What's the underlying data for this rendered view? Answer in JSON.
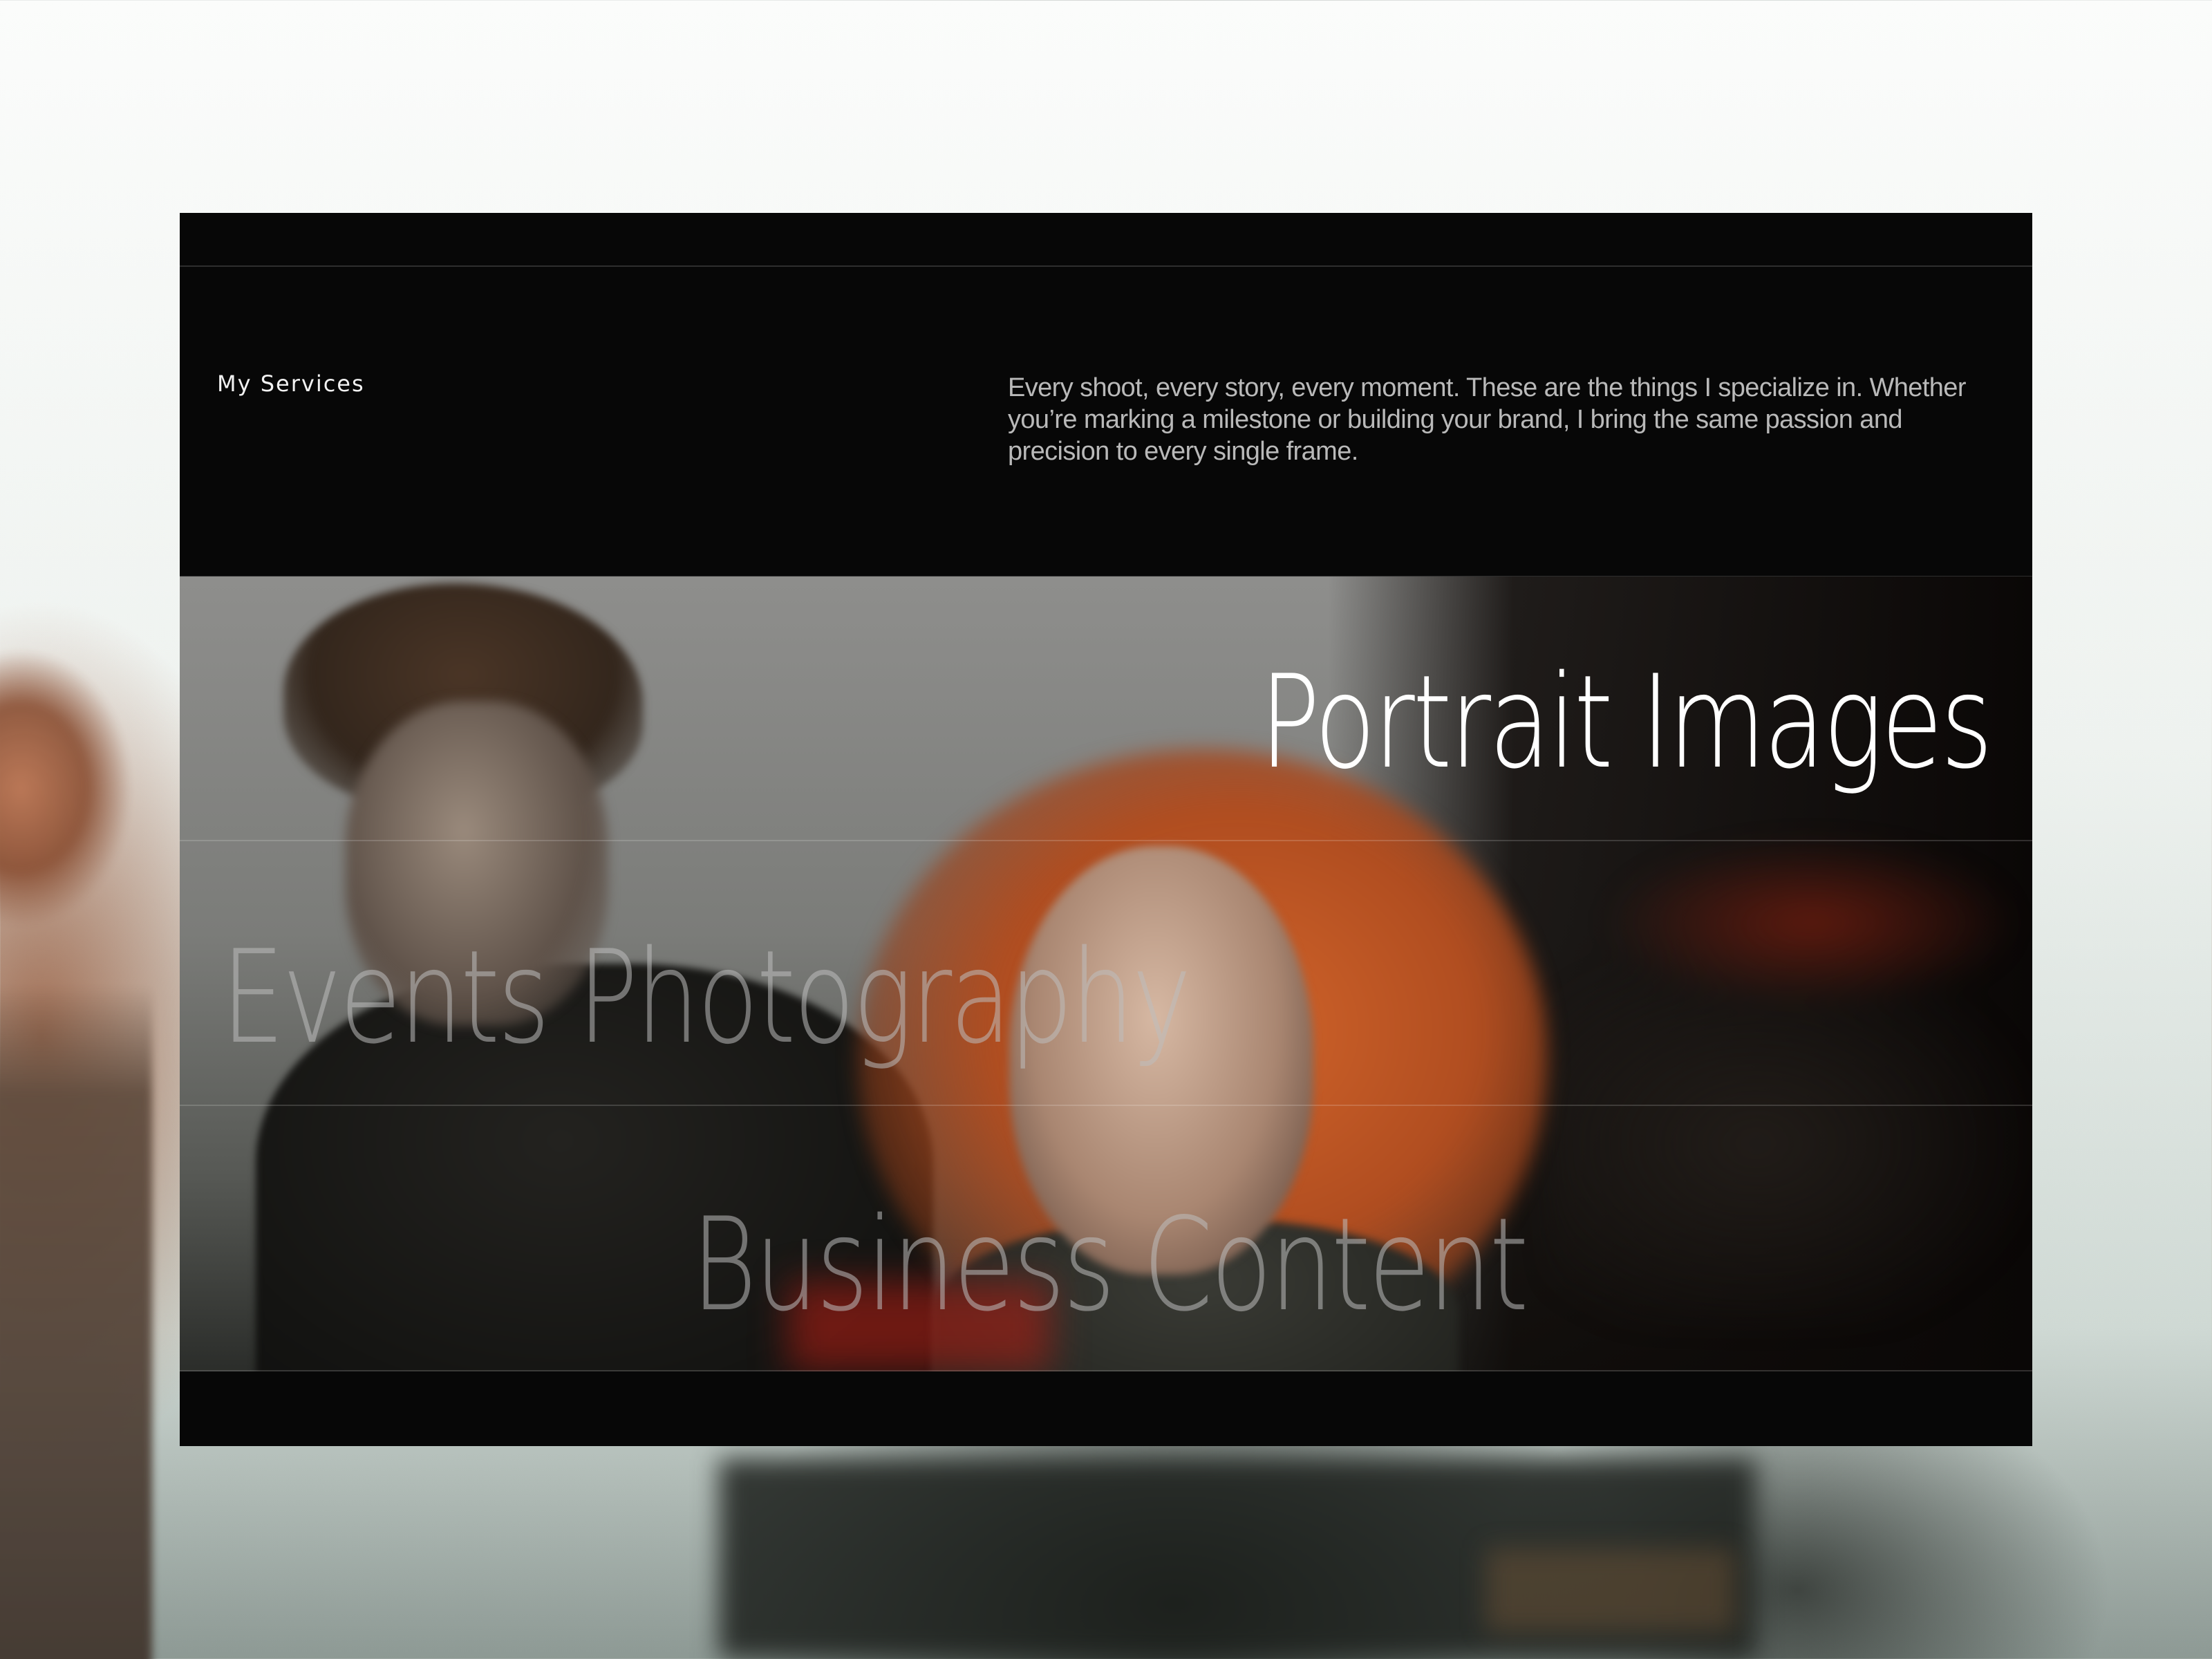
{
  "section": {
    "eyebrow": "My Services",
    "intro": "Every shoot, every story, every moment. These are the things I specialize in. Whether you’re marking a milestone or building your brand, I bring the same passion and precision to every single frame."
  },
  "services": [
    {
      "label": "Portrait Images",
      "active": true
    },
    {
      "label": "Events Photography",
      "active": false
    },
    {
      "label": "Business Content",
      "active": false
    }
  ],
  "colors": {
    "panel_background": "#070707",
    "active_title": "#ffffff",
    "inactive_title": "#bebebe",
    "intro_text": "#b9b9b9",
    "divider": "#ffffff29"
  }
}
